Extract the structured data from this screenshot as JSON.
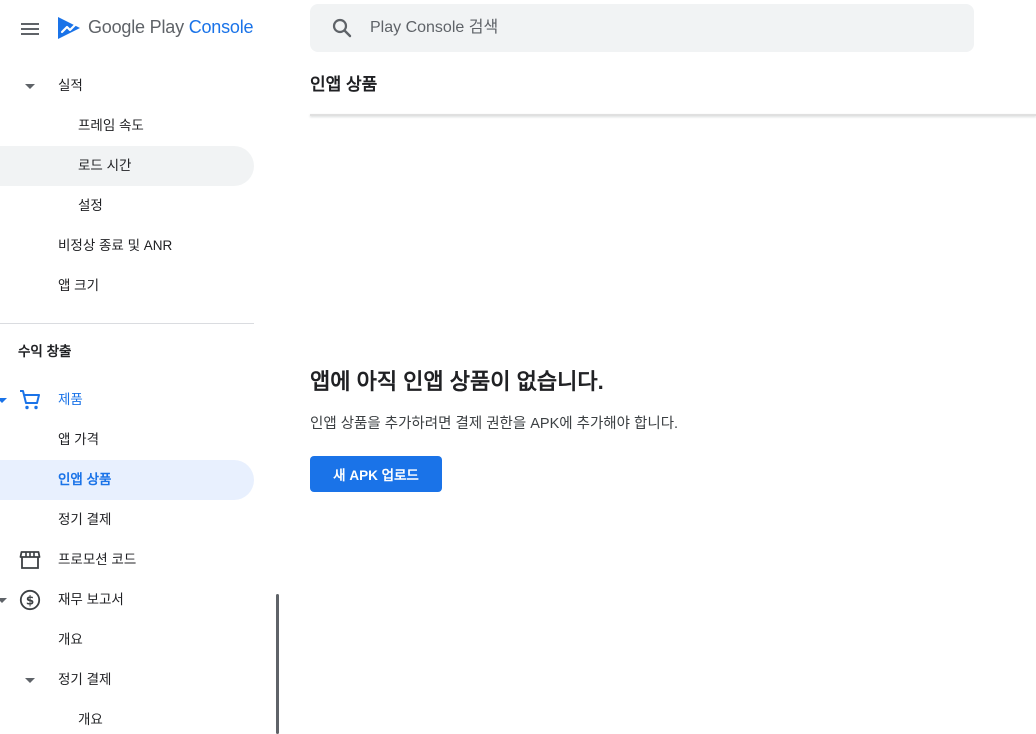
{
  "brand": {
    "word_google": "Google",
    "word_play": "Play",
    "word_console": "Console"
  },
  "search": {
    "placeholder": "Play Console 검색",
    "value": ""
  },
  "sidebar": {
    "performance": {
      "label": "실적",
      "items": [
        "프레임 속도",
        "로드 시간",
        "설정"
      ]
    },
    "crashes_label": "비정상 종료 및 ANR",
    "app_size_label": "앱 크기",
    "section_heading": "수익 창출",
    "products": {
      "label": "제품",
      "items": [
        "앱 가격",
        "인앱 상품",
        "정기 결제"
      ]
    },
    "promo_codes_label": "프로모션 코드",
    "financial_reports": {
      "label": "재무 보고서",
      "overview_label": "개요",
      "subscriptions": {
        "label": "정기 결제",
        "overview_label": "개요"
      }
    }
  },
  "main": {
    "title": "인앱 상품",
    "empty_heading": "앱에 아직 인앱 상품이 없습니다.",
    "empty_body": "인앱 상품을 추가하려면 결제 권한을 APK에 추가해야 합니다.",
    "upload_button_label": "새 APK 업로드"
  },
  "colors": {
    "accent": "#1a73e8",
    "active_nav_background": "#e8f0fe",
    "hover_nav_background": "#f1f3f4",
    "text_primary": "#202124",
    "text_secondary": "#5f6368",
    "divider": "#dadce0"
  },
  "icons": {
    "menu": "menu-icon",
    "logo": "play-console-logo",
    "search": "search-icon",
    "products": "shopping-cart-icon",
    "promo_codes": "storefront-icon",
    "financial_reports": "dollar-circle-icon",
    "expand": "caret-down-icon"
  }
}
